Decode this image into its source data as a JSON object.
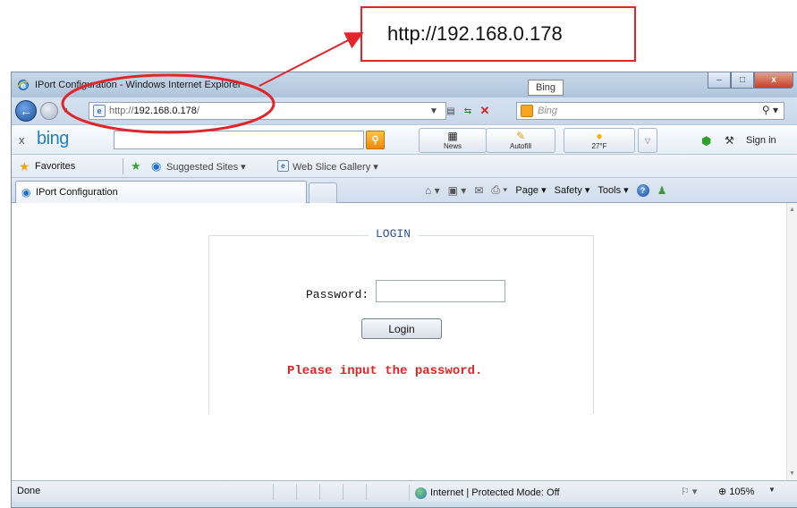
{
  "annotation": {
    "callout_text": "http://192.168.0.178",
    "accent_color": "#e0262a"
  },
  "window": {
    "title": "IPort Configuration - Windows Internet Explorer",
    "tooltip": "Bing",
    "buttons": {
      "minimize": "–",
      "maximize": "□",
      "close": "x"
    }
  },
  "address_bar": {
    "protocol": "http://",
    "host": "192.168.0.178",
    "path": "/",
    "search_placeholder": "Bing"
  },
  "bing_bar": {
    "logo": "bing",
    "close": "x",
    "news_label": "News",
    "autofill_label": "Autofill",
    "weather_label": "27°F",
    "sign_in_label": "Sign in"
  },
  "favorites_bar": {
    "favorites_label": "Favorites",
    "suggested_sites_label": "Suggested Sites ▾",
    "web_slice_gallery_label": "Web Slice Gallery ▾"
  },
  "tabs": {
    "active_label": "IPort Configuration"
  },
  "command_bar": {
    "page_label": "Page ▾",
    "safety_label": "Safety ▾",
    "tools_label": "Tools ▾"
  },
  "login": {
    "legend": "LOGIN",
    "password_label": "Password:",
    "password_value": "",
    "login_button": "Login",
    "error_message": "Please input the password.",
    "error_color": "#e02424"
  },
  "status_bar": {
    "status_text": "Done",
    "zone_text": "Internet | Protected Mode: Off",
    "zoom_text": "105%"
  }
}
